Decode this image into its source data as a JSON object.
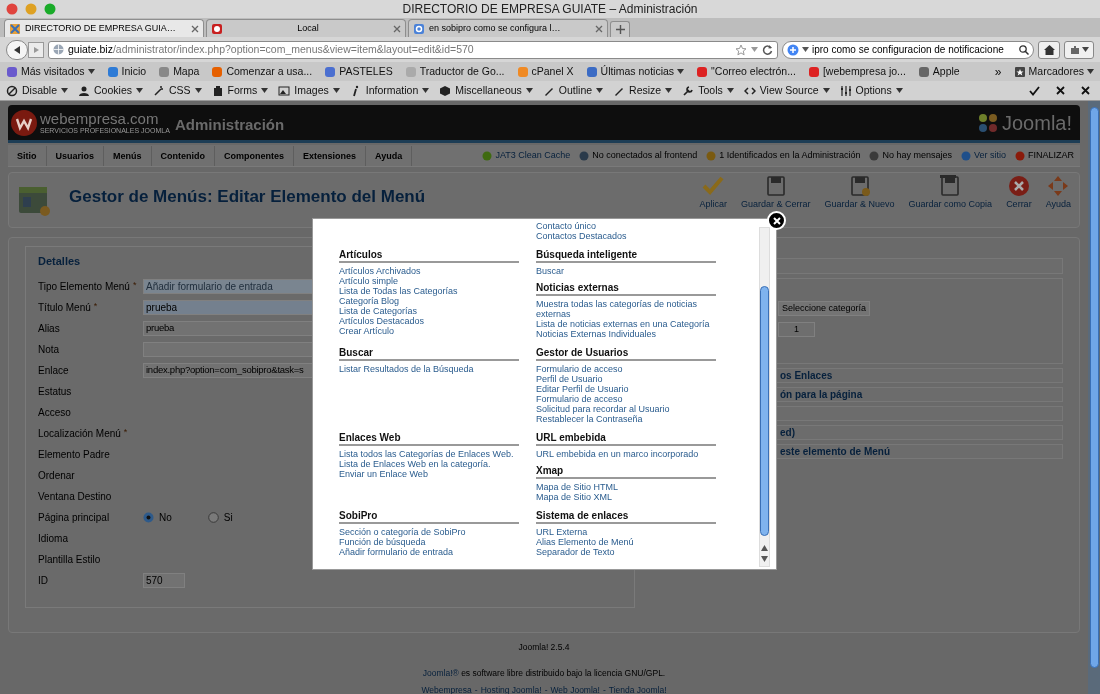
{
  "browser": {
    "title": "DIRECTORIO DE EMPRESA GUIATE – Administración",
    "tabs": [
      {
        "label": "DIRECTORIO DE EMPRESA GUIA…",
        "selected": true
      },
      {
        "label": "Local",
        "selected": false
      },
      {
        "label": "en sobipro como se configura l…",
        "selected": false
      }
    ],
    "url_host": "guiate.biz",
    "url_path": "/administrator/index.php?option=com_menus&view=item&layout=edit&id=570",
    "search": "ipro como se configuracion de notificacione",
    "bookmarks": [
      {
        "label": "Más visitados",
        "menu": true
      },
      {
        "label": "Inicio",
        "menu": false
      },
      {
        "label": "Mapa",
        "menu": false
      },
      {
        "label": "Comenzar a usa...",
        "menu": false
      },
      {
        "label": "PASTELES",
        "menu": false
      },
      {
        "label": "Traductor de Go...",
        "menu": false
      },
      {
        "label": "cPanel X",
        "menu": false
      },
      {
        "label": "Últimas noticias",
        "menu": true
      },
      {
        "label": "\"Correo electrón...",
        "menu": false
      },
      {
        "label": "[webempresa jo...",
        "menu": false
      },
      {
        "label": "Apple",
        "menu": false
      }
    ],
    "more": "»",
    "bookmarks_menu": {
      "label": "Marcadores",
      "menu": true
    },
    "devtools": [
      {
        "label": "Disable",
        "menu": true
      },
      {
        "label": "Cookies",
        "menu": true
      },
      {
        "label": "CSS",
        "menu": true
      },
      {
        "label": "Forms",
        "menu": true
      },
      {
        "label": "Images",
        "menu": true
      },
      {
        "label": "Information",
        "menu": true
      },
      {
        "label": "Miscellaneous",
        "menu": true
      },
      {
        "label": "Outline",
        "menu": true
      },
      {
        "label": "Resize",
        "menu": true
      },
      {
        "label": "Tools",
        "menu": true
      },
      {
        "label": "View Source",
        "menu": true
      },
      {
        "label": "Options",
        "menu": true
      }
    ]
  },
  "header": {
    "brand": "webempresa.com",
    "tagline": "SERVICIOS PROFESIONALES JOOMLA",
    "title": "Administración",
    "product": "Joomla!"
  },
  "menu": [
    "Sitio",
    "Usuarios",
    "Menús",
    "Contenido",
    "Componentes",
    "Extensiones",
    "Ayuda"
  ],
  "status": [
    {
      "label": "JAT3 Clean Cache",
      "link": true
    },
    {
      "label": "No conectados al frontend",
      "link": false
    },
    {
      "label": "1 Identificados en la Administración",
      "link": false
    },
    {
      "label": "No hay mensajes",
      "link": false
    },
    {
      "label": "Ver sitio",
      "link": true
    },
    {
      "label": "FINALIZAR",
      "link": false
    }
  ],
  "page_title": "Gestor de Menús: Editar Elemento del Menú",
  "toolbar": [
    {
      "label": "Aplicar",
      "kind": "apply"
    },
    {
      "label": "Guardar & Cerrar",
      "kind": "save"
    },
    {
      "label": "Guardar & Nuevo",
      "kind": "save-new"
    },
    {
      "label": "Guardar como Copia",
      "kind": "copy"
    },
    {
      "label": "Cerrar",
      "kind": "cancel"
    },
    {
      "label": "Ayuda",
      "kind": "help"
    }
  ],
  "details": {
    "legend": "Detalles",
    "rows": [
      {
        "label": "Tipo Elemento Menú",
        "marker": "*",
        "kind": "readonly",
        "value": "Añadir formulario de entrada"
      },
      {
        "label": "Título Menú",
        "marker": "*",
        "kind": "highlight",
        "value": "prueba"
      },
      {
        "label": "Alias",
        "kind": "text",
        "value": "prueba"
      },
      {
        "label": "Nota",
        "kind": "text"
      },
      {
        "label": "Enlace",
        "kind": "text",
        "value": "index.php?option=com_sobipro&task=s"
      },
      {
        "label": "Estatus",
        "kind": "none"
      },
      {
        "label": "Acceso",
        "kind": "none"
      },
      {
        "label": "Localización Menú",
        "marker": "*",
        "kind": "none"
      },
      {
        "label": "Elemento Padre",
        "kind": "none"
      },
      {
        "label": "Ordenar",
        "kind": "none"
      },
      {
        "label": "Ventana Destino",
        "kind": "none"
      },
      {
        "label": "Página principal",
        "kind": "radio",
        "options": [
          {
            "label": "No",
            "selected": true
          },
          {
            "label": "Si",
            "selected": false
          }
        ]
      },
      {
        "label": "Idioma",
        "kind": "none"
      },
      {
        "label": "Plantilla Estilo",
        "kind": "none"
      },
      {
        "label": "ID",
        "kind": "short",
        "value": "570"
      }
    ]
  },
  "side": {
    "category_button": "Seleccione categoría",
    "count": "1",
    "panels": [
      {
        "kind": "titled",
        "title": "os Enlaces"
      },
      {
        "kind": "titled",
        "title": "ón para la página"
      },
      {
        "kind": "blank"
      },
      {
        "kind": "titled",
        "title": "ed)"
      },
      {
        "kind": "titled",
        "title": "este elemento de Menú"
      }
    ]
  },
  "modal": {
    "rows": [
      {
        "left": [],
        "right": [
          {
            "items": [
              "Contacto único",
              "Contactos Destacados"
            ]
          }
        ]
      },
      {
        "left": [
          {
            "heading": "Artículos",
            "items": [
              "Artículos Archivados",
              "Artículo simple",
              "Lista de Todas las Categorías",
              "Categoría Blog",
              "Lista de Categorías",
              "Artículos Destacados",
              "Crear Artículo"
            ]
          }
        ],
        "right": [
          {
            "heading": "Búsqueda inteligente",
            "items": [
              "Buscar"
            ]
          },
          {
            "heading": "Noticias externas",
            "items": [
              "Muestra todas las categorías de noticias externas",
              "Lista de noticias externas en una Categoría",
              "Noticias Externas Individuales"
            ]
          }
        ]
      },
      {
        "left": [
          {
            "heading": "Buscar",
            "items": [
              "Listar Resultados de la Búsqueda"
            ]
          }
        ],
        "right": [
          {
            "heading": "Gestor de Usuarios",
            "items": [
              "Formulario de acceso",
              "Perfil de Usuario",
              "Editar Perfil de Usuario",
              "Formulario de acceso",
              "Solicitud para recordar al Usuario",
              "Restablecer la Contraseña"
            ]
          }
        ]
      },
      {
        "left": [
          {
            "heading": "Enlaces Web",
            "items": [
              "Lista todos las Categorías de Enlaces Web.",
              "Lista de Enlaces Web en la categoría.",
              "Enviar un Enlace Web"
            ]
          }
        ],
        "right": [
          {
            "heading": "URL embebida",
            "items": [
              "URL embebida en un marco incorporado"
            ]
          },
          {
            "heading": "Xmap",
            "items": [
              "Mapa de Sitio HTML",
              "Mapa de Sitio XML"
            ]
          }
        ]
      },
      {
        "left": [
          {
            "heading": "SobiPro",
            "items": [
              "Sección o categoría de SobiPro",
              "Función de búsqueda",
              "Añadir formulario de entrada"
            ]
          }
        ],
        "right": [
          {
            "heading": "Sistema de enlaces",
            "items": [
              "URL Externa",
              "Alias Elemento de Menú",
              "Separador de Texto"
            ]
          }
        ]
      }
    ]
  },
  "footer": {
    "version": "Joomla! 2.5.4",
    "license_link": "Joomla!®",
    "license": "es software libre distribuido bajo la licencia GNU/GPL.",
    "links": [
      "Webempresa",
      "Hosting Joomla!",
      "Web Joomla!",
      "Tienda Joomla!"
    ],
    "separator": "-"
  }
}
